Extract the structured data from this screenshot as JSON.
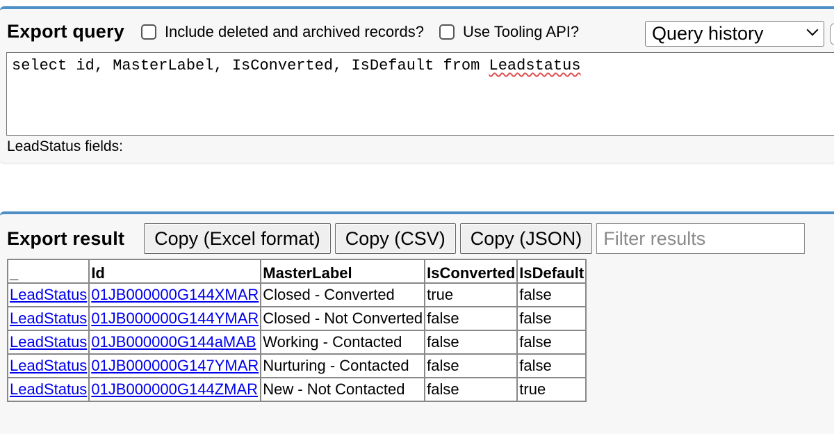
{
  "query": {
    "title": "Export query",
    "include_deleted_label": "Include deleted and archived records?",
    "use_tooling_label": "Use Tooling API?",
    "history_select": "Query history",
    "soql_before": "select id, MasterLabel, IsConverted, IsDefault from ",
    "soql_object": "Leadstatus",
    "fields_label": "LeadStatus fields:"
  },
  "result": {
    "title": "Export result",
    "copy_excel": "Copy (Excel format)",
    "copy_csv": "Copy (CSV)",
    "copy_json": "Copy (JSON)",
    "filter_placeholder": "Filter results",
    "columns": [
      "_",
      "Id",
      "MasterLabel",
      "IsConverted",
      "IsDefault"
    ],
    "rows": [
      [
        "LeadStatus",
        "01JB000000G144XMAR",
        "Closed - Converted",
        "true",
        "false"
      ],
      [
        "LeadStatus",
        "01JB000000G144YMAR",
        "Closed - Not Converted",
        "false",
        "false"
      ],
      [
        "LeadStatus",
        "01JB000000G144aMAB",
        "Working - Contacted",
        "false",
        "false"
      ],
      [
        "LeadStatus",
        "01JB000000G147YMAR",
        "Nurturing - Contacted",
        "false",
        "false"
      ],
      [
        "LeadStatus",
        "01JB000000G144ZMAR",
        "New - Not Contacted",
        "false",
        "true"
      ]
    ]
  },
  "colors": {
    "accent": "#4e8fc6",
    "link": "#0000ee",
    "spellcheck": "#e05050"
  }
}
